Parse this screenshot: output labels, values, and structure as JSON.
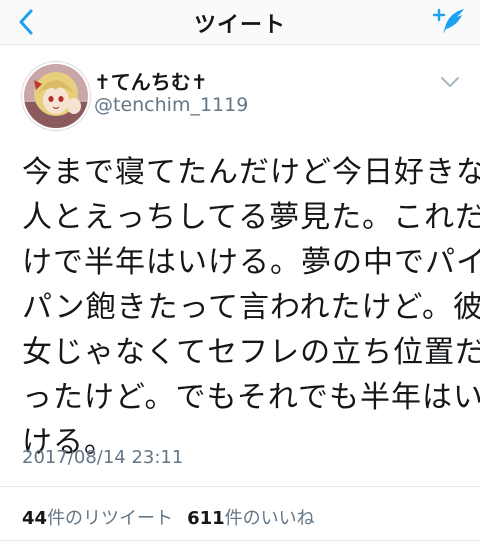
{
  "navbar": {
    "title": "ツイート",
    "back_icon": "chevron-left-icon",
    "compose_icon": "compose-tweet-icon",
    "accent_color": "#1da1f2"
  },
  "author": {
    "display_name": "✝てんちむ✝",
    "handle": "@tenchim_1119",
    "menu_icon": "chevron-down-icon"
  },
  "tweet": {
    "lines": [
      "今まで寝てたんだけど今日好きな",
      "人とえっちしてる夢見た。これだ",
      "けで半年はいける。夢の中でパイ",
      "パン飽きたって言われたけど。彼",
      "女じゃなくてセフレの立ち位置だ",
      "ったけど。でもそれでも半年はい",
      "ける。"
    ],
    "timestamp": "2017/08/14 23:11"
  },
  "stats": {
    "retweets_count": "44",
    "retweets_label": "件のリツイート",
    "likes_count": "611",
    "likes_label": "件のいいね"
  }
}
